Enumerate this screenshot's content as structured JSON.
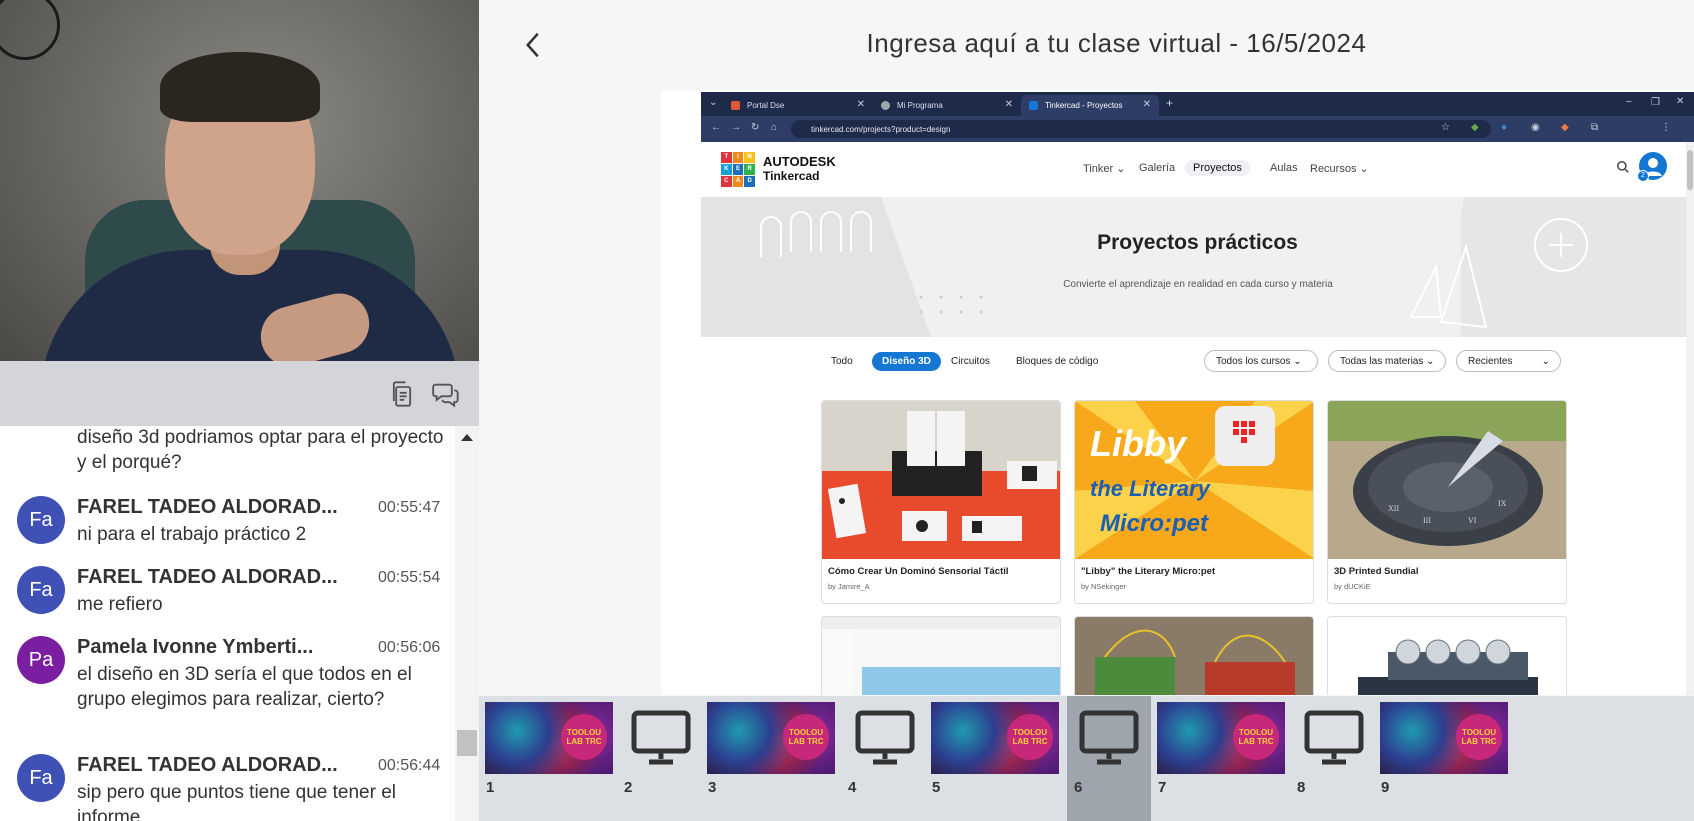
{
  "meeting": {
    "title": "Ingresa aquí a tu clase virtual - 16/5/2024"
  },
  "chat": {
    "partial_message": {
      "text": "diseño 3d podriamos optar para el proyecto y el porqué?"
    },
    "messages": [
      {
        "initials": "Fa",
        "color": "#3f51b5",
        "name": "FAREL TADEO ALDORAD...",
        "time": "00:55:47",
        "text": "ni para el trabajo práctico 2"
      },
      {
        "initials": "Fa",
        "color": "#3f51b5",
        "name": "FAREL TADEO ALDORAD...",
        "time": "00:55:54",
        "text": "me refiero"
      },
      {
        "initials": "Pa",
        "color": "#7b1fa2",
        "name": "Pamela Ivonne Ymberti...",
        "time": "00:56:06",
        "text": "el diseño en 3D sería el que todos en el grupo elegimos para realizar, cierto?"
      },
      {
        "initials": "Fa",
        "color": "#3f51b5",
        "name": "FAREL TADEO ALDORAD...",
        "time": "00:56:44",
        "text": "sip pero que puntos tiene que tener el informe"
      }
    ]
  },
  "browser": {
    "tabs": [
      {
        "label": "Portal Dse",
        "fav_color": "#e05a3a"
      },
      {
        "label": "Mi Programa",
        "fav_color": "#9aa"
      },
      {
        "label": "Tinkercad - Proyectos",
        "fav_color": "#1477d4"
      }
    ],
    "url": "tinkercad.com/projects?product=design"
  },
  "tinkercad": {
    "logo_letters": [
      "T",
      "I",
      "N",
      "K",
      "E",
      "R",
      "C",
      "A",
      "D"
    ],
    "logo_colors": [
      "#e2333a",
      "#f28a1b",
      "#f7c21c",
      "#18a1d9",
      "#1c6fb8",
      "#2bb34a",
      "#e2333a",
      "#f28a1b",
      "#1c6fb8"
    ],
    "brand_line1": "AUTODESK",
    "brand_line2": "Tinkercad",
    "nav": [
      "Tinker",
      "Galería",
      "Proyectos",
      "Aulas",
      "Recursos"
    ],
    "avatar_badge": "2",
    "hero_title": "Proyectos prácticos",
    "hero_subtitle": "Convierte el aprendizaje en realidad en cada curso y materia",
    "filter_tabs": [
      "Todo",
      "Diseño 3D",
      "Circuitos",
      "Bloques de código"
    ],
    "filter_selects": [
      "Todos los cursos",
      "Todas las materias",
      "Recientes"
    ],
    "cards": [
      {
        "title": "Cómo Crear Un Dominó Sensorial Táctil",
        "by": "by Jamire_A"
      },
      {
        "title": "\"Libby\" the Literary Micro:pet",
        "by": "by NSekinger"
      },
      {
        "title": "3D Printed Sundial",
        "by": "by dUCKiE"
      }
    ],
    "libby_art_text": "Libby the Literary Micro:pet"
  },
  "filmstrip": {
    "slides": [
      {
        "number": "1",
        "kind": "image"
      },
      {
        "number": "2",
        "kind": "screen"
      },
      {
        "number": "3",
        "kind": "image"
      },
      {
        "number": "4",
        "kind": "screen"
      },
      {
        "number": "5",
        "kind": "image"
      },
      {
        "number": "6",
        "kind": "screen",
        "selected": true
      },
      {
        "number": "7",
        "kind": "image"
      },
      {
        "number": "8",
        "kind": "screen"
      },
      {
        "number": "9",
        "kind": "image"
      }
    ],
    "badge_text": "TOOLOU LAB TRC"
  }
}
